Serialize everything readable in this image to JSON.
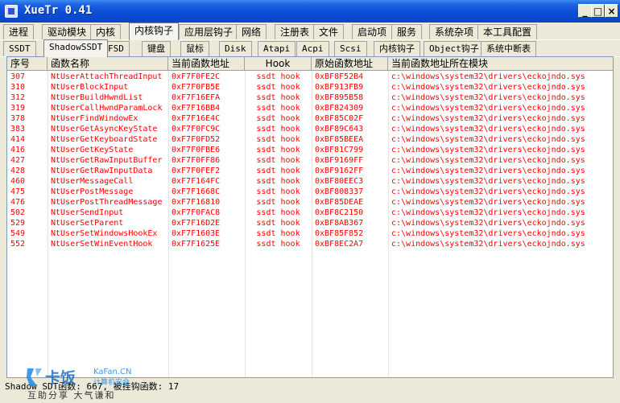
{
  "window": {
    "title": "XueTr 0.41"
  },
  "main_tabs": [
    "进程",
    "驱动模块",
    "内核",
    "内核钩子",
    "应用层钩子",
    "网络",
    "注册表",
    "文件",
    "启动项",
    "服务",
    "系统杂项",
    "本工具配置"
  ],
  "sub_tabs": [
    "SSDT",
    "ShadowSSDT",
    "FSD",
    "键盘",
    "鼠标",
    "Disk",
    "Atapi",
    "Acpi",
    "Scsi",
    "内核钩子",
    "Object钩子",
    "系统中断表"
  ],
  "columns": [
    "序号",
    "函数名称",
    "当前函数地址",
    "Hook",
    "原始函数地址",
    "当前函数地址所在模块"
  ],
  "rows": [
    {
      "id": "307",
      "name": "NtUserAttachThreadInput",
      "cur": "0xF7F0FE2C",
      "hook": "ssdt hook",
      "orig": "0xBF8F52B4",
      "module": "c:\\windows\\system32\\drivers\\eckojndo.sys"
    },
    {
      "id": "310",
      "name": "NtUserBlockInput",
      "cur": "0xF7F0FB5E",
      "hook": "ssdt hook",
      "orig": "0xBF913FB9",
      "module": "c:\\windows\\system32\\drivers\\eckojndo.sys"
    },
    {
      "id": "312",
      "name": "NtUserBuildHwndList",
      "cur": "0xF7F16EFA",
      "hook": "ssdt hook",
      "orig": "0xBF895B58",
      "module": "c:\\windows\\system32\\drivers\\eckojndo.sys"
    },
    {
      "id": "319",
      "name": "NtUserCallHwndParamLock",
      "cur": "0xF7F16BB4",
      "hook": "ssdt hook",
      "orig": "0xBF824309",
      "module": "c:\\windows\\system32\\drivers\\eckojndo.sys"
    },
    {
      "id": "378",
      "name": "NtUserFindWindowEx",
      "cur": "0xF7F16E4C",
      "hook": "ssdt hook",
      "orig": "0xBF85C02F",
      "module": "c:\\windows\\system32\\drivers\\eckojndo.sys"
    },
    {
      "id": "383",
      "name": "NtUserGetAsyncKeyState",
      "cur": "0xF7F0FC9C",
      "hook": "ssdt hook",
      "orig": "0xBF89C643",
      "module": "c:\\windows\\system32\\drivers\\eckojndo.sys"
    },
    {
      "id": "414",
      "name": "NtUserGetKeyboardState",
      "cur": "0xF7F0FD52",
      "hook": "ssdt hook",
      "orig": "0xBF85BEEA",
      "module": "c:\\windows\\system32\\drivers\\eckojndo.sys"
    },
    {
      "id": "416",
      "name": "NtUserGetKeyState",
      "cur": "0xF7F0FBE6",
      "hook": "ssdt hook",
      "orig": "0xBF81C799",
      "module": "c:\\windows\\system32\\drivers\\eckojndo.sys"
    },
    {
      "id": "427",
      "name": "NtUserGetRawInputBuffer",
      "cur": "0xF7F0FF86",
      "hook": "ssdt hook",
      "orig": "0xBF9169FF",
      "module": "c:\\windows\\system32\\drivers\\eckojndo.sys"
    },
    {
      "id": "428",
      "name": "NtUserGetRawInputData",
      "cur": "0xF7F0FEF2",
      "hook": "ssdt hook",
      "orig": "0xBF9162FF",
      "module": "c:\\windows\\system32\\drivers\\eckojndo.sys"
    },
    {
      "id": "460",
      "name": "NtUserMessageCall",
      "cur": "0xF7F164FC",
      "hook": "ssdt hook",
      "orig": "0xBF80EEC3",
      "module": "c:\\windows\\system32\\drivers\\eckojndo.sys"
    },
    {
      "id": "475",
      "name": "NtUserPostMessage",
      "cur": "0xF7F1668C",
      "hook": "ssdt hook",
      "orig": "0xBF808337",
      "module": "c:\\windows\\system32\\drivers\\eckojndo.sys"
    },
    {
      "id": "476",
      "name": "NtUserPostThreadMessage",
      "cur": "0xF7F16810",
      "hook": "ssdt hook",
      "orig": "0xBF85DEAE",
      "module": "c:\\windows\\system32\\drivers\\eckojndo.sys"
    },
    {
      "id": "502",
      "name": "NtUserSendInput",
      "cur": "0xF7F0FAC8",
      "hook": "ssdt hook",
      "orig": "0xBF8C2150",
      "module": "c:\\windows\\system32\\drivers\\eckojndo.sys"
    },
    {
      "id": "529",
      "name": "NtUserSetParent",
      "cur": "0xF7F16D2E",
      "hook": "ssdt hook",
      "orig": "0xBF8AB367",
      "module": "c:\\windows\\system32\\drivers\\eckojndo.sys"
    },
    {
      "id": "549",
      "name": "NtUserSetWindowsHookEx",
      "cur": "0xF7F1603E",
      "hook": "ssdt hook",
      "orig": "0xBF85F852",
      "module": "c:\\windows\\system32\\drivers\\eckojndo.sys"
    },
    {
      "id": "552",
      "name": "NtUserSetWinEventHook",
      "cur": "0xF7F1625E",
      "hook": "ssdt hook",
      "orig": "0xBF8EC2A7",
      "module": "c:\\windows\\system32\\drivers\\eckojndo.sys"
    }
  ],
  "status": {
    "label_a": "Shadow",
    "label_b": "SDT函数:",
    "total": "667",
    "label_c": "被挂钩函数:",
    "hooked": "17"
  },
  "footer": {
    "text": "互助分享   大气谦和"
  },
  "watermark": {
    "brand": "卡饭",
    "site": "KaFan.CN",
    "subtitle": "计算机安全"
  },
  "colors": {
    "hook_text": "#ff0000",
    "titlebar": "#0a4fd8"
  },
  "icons": {
    "app": "app-icon",
    "minimize": "minimize-icon",
    "maximize": "maximize-icon",
    "close": "close-icon"
  }
}
